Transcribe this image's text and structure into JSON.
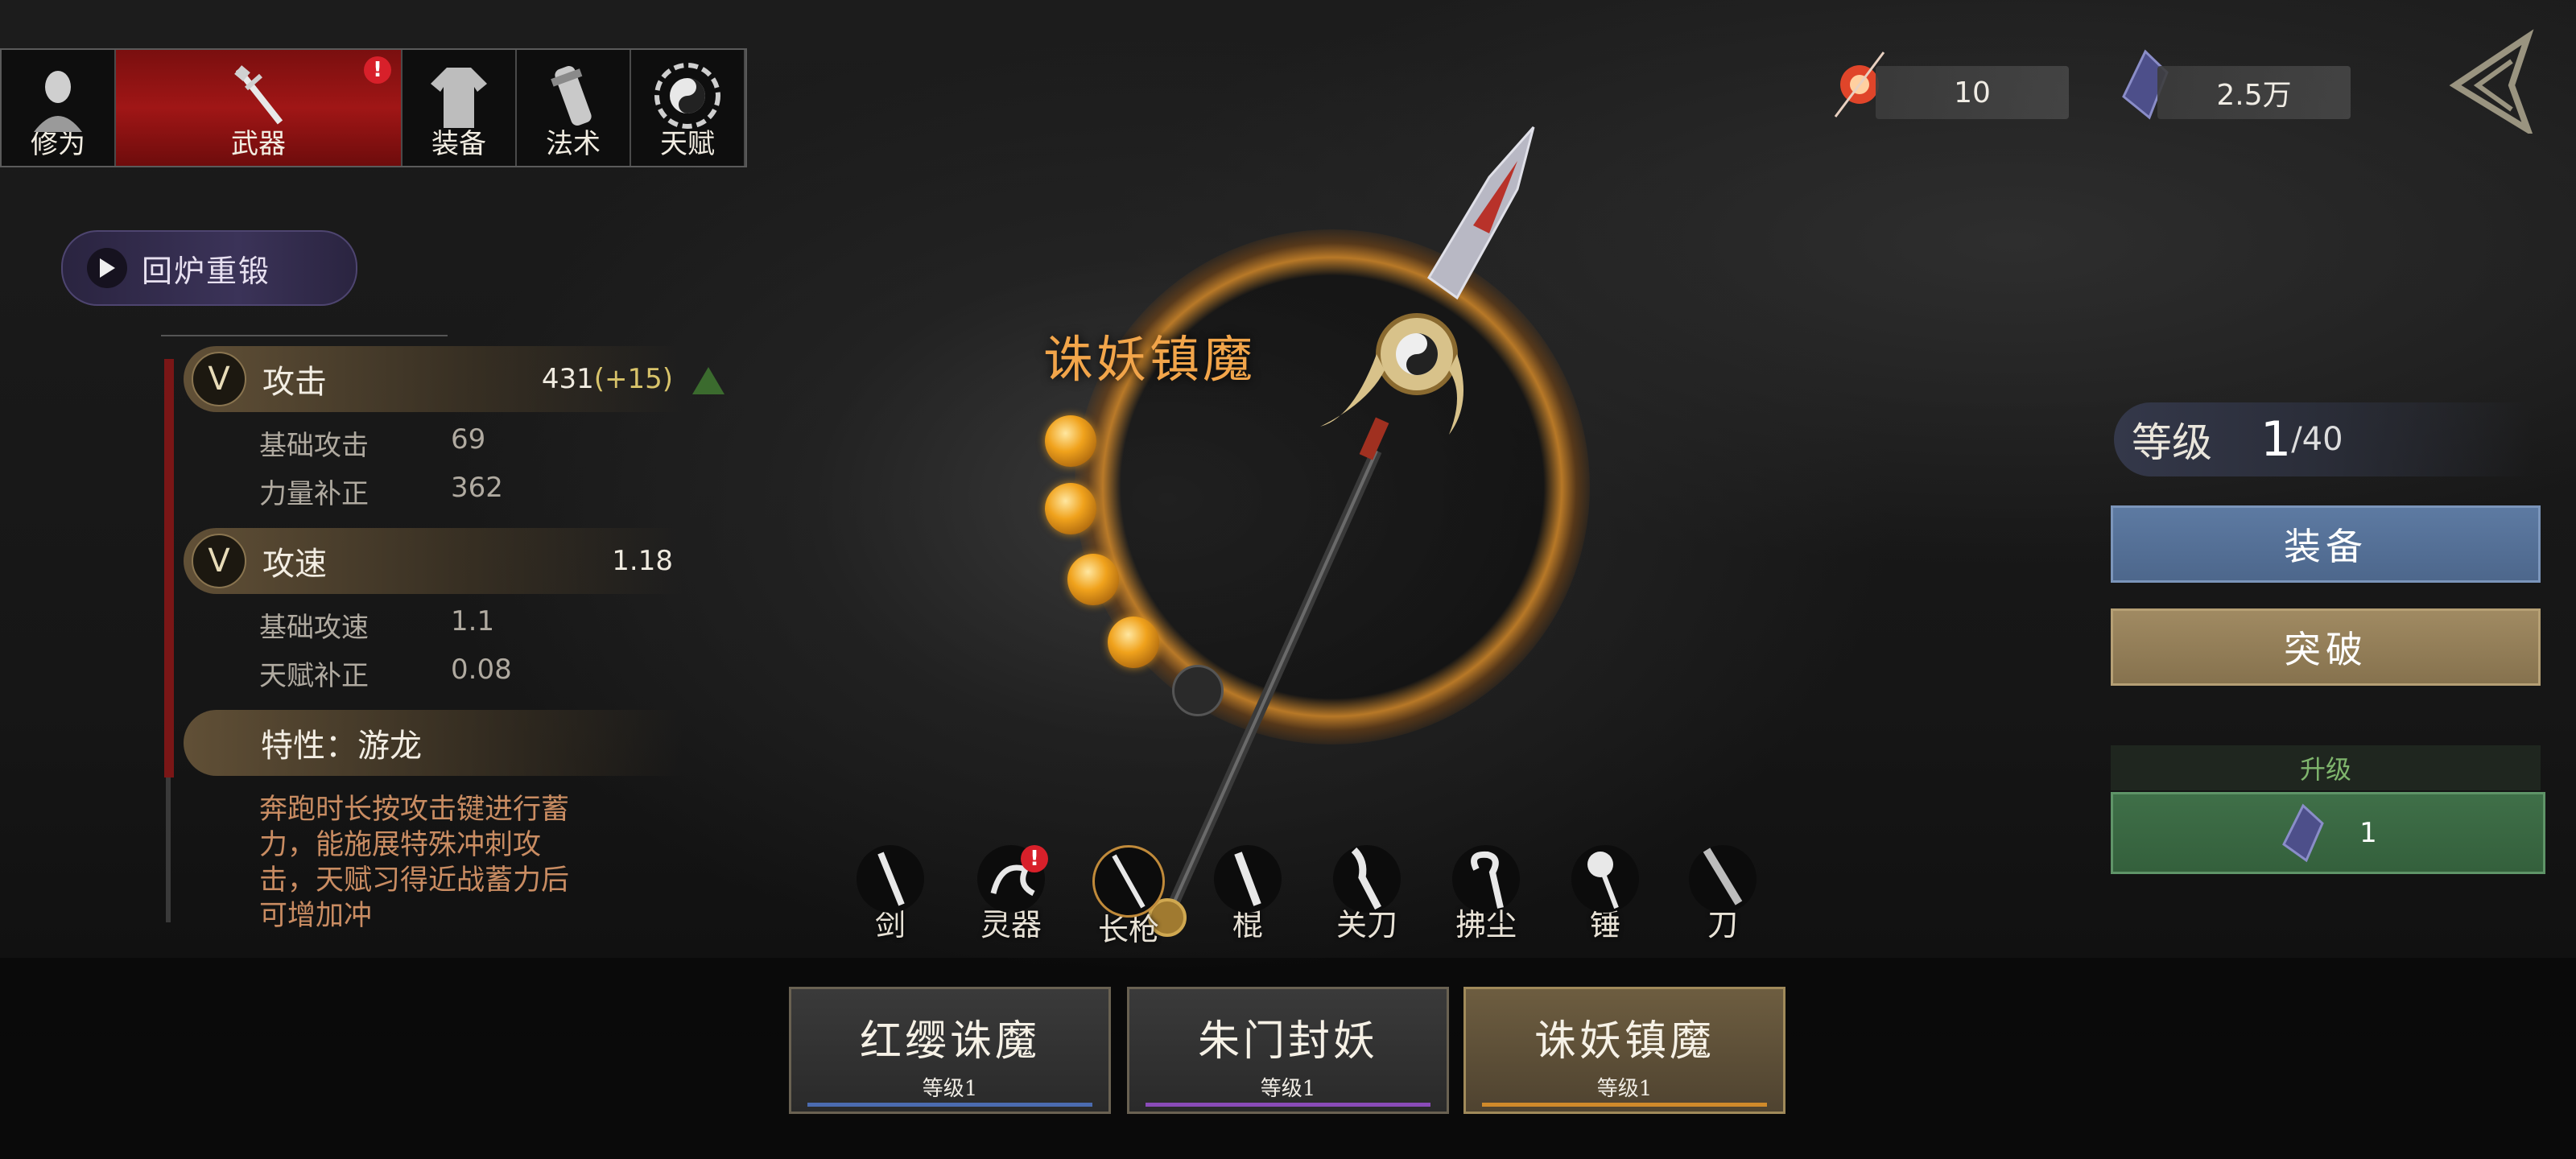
{
  "tabs": [
    {
      "label": "修为",
      "icon": "cultivator-portrait-icon"
    },
    {
      "label": "武器",
      "icon": "sword-icon",
      "active": true,
      "alert": "!"
    },
    {
      "label": "装备",
      "icon": "robe-icon"
    },
    {
      "label": "法术",
      "icon": "scroll-icon"
    },
    {
      "label": "天赋",
      "icon": "bagua-icon"
    }
  ],
  "recast_label": "回炉重锻",
  "stats": {
    "attack": {
      "name": "攻击",
      "value": "431",
      "bonus": "(+15)",
      "rows": [
        {
          "label": "基础攻击",
          "value": "69"
        },
        {
          "label": "力量补正",
          "value": "362"
        }
      ]
    },
    "speed": {
      "name": "攻速",
      "value": "1.18",
      "rows": [
        {
          "label": "基础攻速",
          "value": "1.1"
        },
        {
          "label": "天赋补正",
          "value": "0.08"
        }
      ]
    },
    "trait": {
      "name": "特性：游龙",
      "text": "奔跑时长按攻击键进行蓄力，能施展特殊冲刺攻击，天赋习得近战蓄力后可增加冲"
    }
  },
  "weapon_name": "诛妖镇魔",
  "charge_orbs": {
    "filled": 4,
    "total": 5
  },
  "currency": {
    "c1": "10",
    "c2": "2.5万"
  },
  "level": {
    "label": "等级",
    "current": "1",
    "max": "/40"
  },
  "buttons": {
    "equip": "装备",
    "breakthrough": "突破",
    "upgrade_label": "升级",
    "upgrade_cost": "1"
  },
  "weapon_types": [
    "剑",
    "灵器",
    "长枪",
    "棍",
    "关刀",
    "拂尘",
    "锤",
    "刀"
  ],
  "weapon_type_alert": "!",
  "cards": [
    {
      "name": "红缨诛魔",
      "level": "等级1",
      "color": "#4b6bb0"
    },
    {
      "name": "朱门封妖",
      "level": "等级1",
      "color": "#8a4bb8"
    },
    {
      "name": "诛妖镇魔",
      "level": "等级1",
      "color": "#d08a2a"
    }
  ]
}
